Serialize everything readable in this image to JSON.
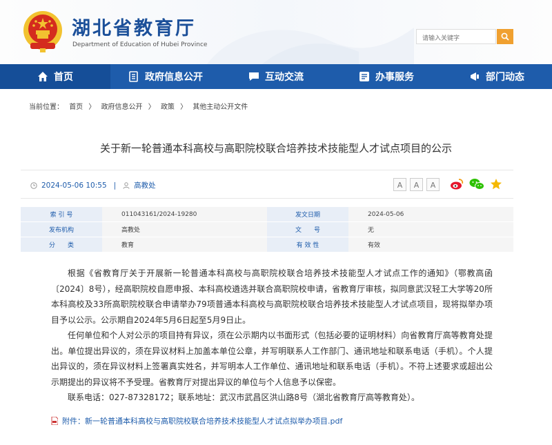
{
  "site": {
    "title": "湖北省教育厅",
    "subtitle": "Department of Education of Hubei Province"
  },
  "search": {
    "placeholder": "请输入关键字"
  },
  "nav": [
    {
      "label": "首页",
      "icon": "home-icon"
    },
    {
      "label": "政府信息公开",
      "icon": "document-icon"
    },
    {
      "label": "互动交流",
      "icon": "chat-icon"
    },
    {
      "label": "办事服务",
      "icon": "service-icon"
    },
    {
      "label": "部门动态",
      "icon": "news-icon"
    }
  ],
  "breadcrumb": {
    "prefix": "当前位置：",
    "items": [
      "首页",
      "政府信息公开",
      "政策",
      "其他主动公开文件"
    ],
    "separator": "〉"
  },
  "article": {
    "title": "关于新一轮普通本科高校与高职院校联合培养技术技能型人才试点项目的公示",
    "date": "2024-05-06 10:55",
    "source": "高教处",
    "font_sizes": [
      "A",
      "A",
      "A"
    ],
    "share_icons": [
      "weibo-icon",
      "wechat-icon",
      "favorite-icon"
    ]
  },
  "info": [
    {
      "k1": "索 引 号",
      "v1": "011043161/2024-19280",
      "k2": "发文日期",
      "v2": "2024-05-06"
    },
    {
      "k1": "发布机构",
      "v1": "高教处",
      "k2": "文　　号",
      "v2": "无"
    },
    {
      "k1": "分　　类",
      "v1": "教育",
      "k2": "有 效 性",
      "v2": "有效"
    }
  ],
  "body": {
    "p1": "根据《省教育厅关于开展新一轮普通本科高校与高职院校联合培养技术技能型人才试点工作的通知》（鄂教高函〔2024〕8号），经高职院校自愿申报、本科高校遴选并联合高职院校申请，省教育厅审核，拟同意武汉轻工大学等20所本科高校及33所高职院校联合申请举办79项普通本科高校与高职院校联合培养技术技能型人才试点项目，现将拟举办项目予以公示。公示期自2024年5月6日起至5月9日止。",
    "p2": "任何单位和个人对公示的项目持有异议，须在公示期内以书面形式（包括必要的证明材料）向省教育厅高等教育处提出。单位提出异议的，须在异议材料上加盖本单位公章，并写明联系人工作部门、通讯地址和联系电话（手机）。个人提出异议的，须在异议材料上签署真实姓名，并写明本人工作单位、通讯地址和联系电话（手机）。不符上述要求或超出公示期提出的异议将不予受理。省教育厅对提出异议的单位与个人信息予以保密。",
    "p3": "联系电话：027-87328172；联系地址：武汉市武昌区洪山路8号（湖北省教育厅高等教育处）。"
  },
  "attachment": "附件：新一轮普通本科高校与高职院校联合培养技术技能型人才试点拟举办项目.pdf",
  "colors": {
    "primary": "#1e5cab",
    "accent": "#f0a030",
    "emblem_red": "#d42b1e",
    "emblem_gold": "#f2c230"
  }
}
